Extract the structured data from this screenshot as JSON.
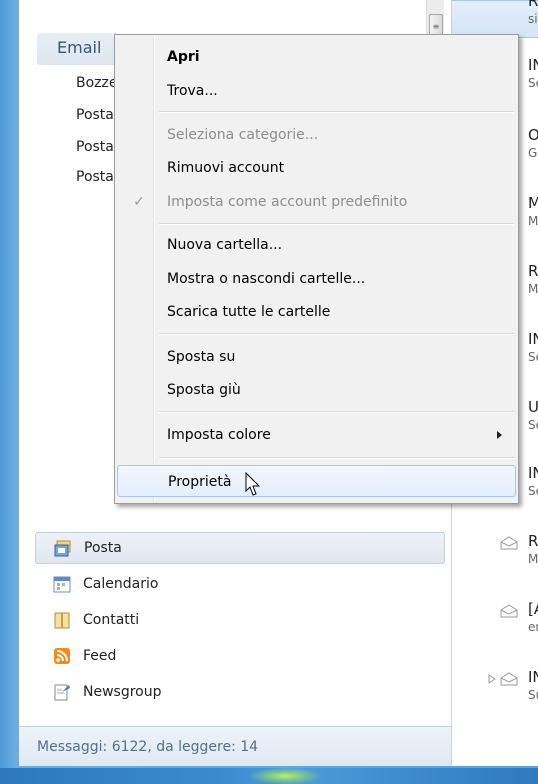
{
  "folder_pane": {
    "email_header": "Email",
    "folders": [
      "Bozze",
      "Posta",
      "Posta",
      "Posta"
    ]
  },
  "context_menu": {
    "items": [
      {
        "label": "Apri",
        "state": "bold"
      },
      {
        "label": "Trova..."
      },
      {
        "label": "Seleziona categorie...",
        "state": "disabled"
      },
      {
        "label": "Rimuovi account"
      },
      {
        "label": "Imposta come account predefinito",
        "state": "disabled",
        "checked": true
      },
      {
        "label": "Nuova cartella..."
      },
      {
        "label": "Mostra o nascondi cartelle..."
      },
      {
        "label": "Scarica tutte le cartelle"
      },
      {
        "label": "Sposta su"
      },
      {
        "label": "Sposta giù"
      },
      {
        "label": "Imposta colore",
        "submenu": true
      },
      {
        "label": "Proprietà",
        "state": "hover"
      }
    ],
    "check_glyph": "✓"
  },
  "message_list": [
    {
      "title": "Re",
      "sub": "sir",
      "selected": true
    },
    {
      "title": "IN",
      "sub": "Se"
    },
    {
      "title": "Ol",
      "sub": "Go"
    },
    {
      "title": "M",
      "sub": "M"
    },
    {
      "title": "Re",
      "sub": "M"
    },
    {
      "title": "IN",
      "sub": "Se"
    },
    {
      "title": "U",
      "sub": "Se"
    },
    {
      "title": "IN",
      "sub": "Se"
    },
    {
      "title": "Re",
      "sub": "M"
    },
    {
      "title": "[A",
      "sub": "en"
    },
    {
      "title": "IN",
      "sub": "Su"
    }
  ],
  "nav": {
    "items": [
      {
        "label": "Posta",
        "icon": "mail-icon",
        "selected": true
      },
      {
        "label": "Calendario",
        "icon": "calendar-icon"
      },
      {
        "label": "Contatti",
        "icon": "contacts-icon"
      },
      {
        "label": "Feed",
        "icon": "rss-feed-icon"
      },
      {
        "label": "Newsgroup",
        "icon": "newsgroup-icon"
      }
    ]
  },
  "status_bar": {
    "text": "Messaggi: 6122, da leggere: 14"
  },
  "colors": {
    "menu_bg": "#f1f1f1",
    "hover_border": "#a8c7ef",
    "status_text": "#576d8a",
    "rss_orange": "#f28a1e"
  }
}
